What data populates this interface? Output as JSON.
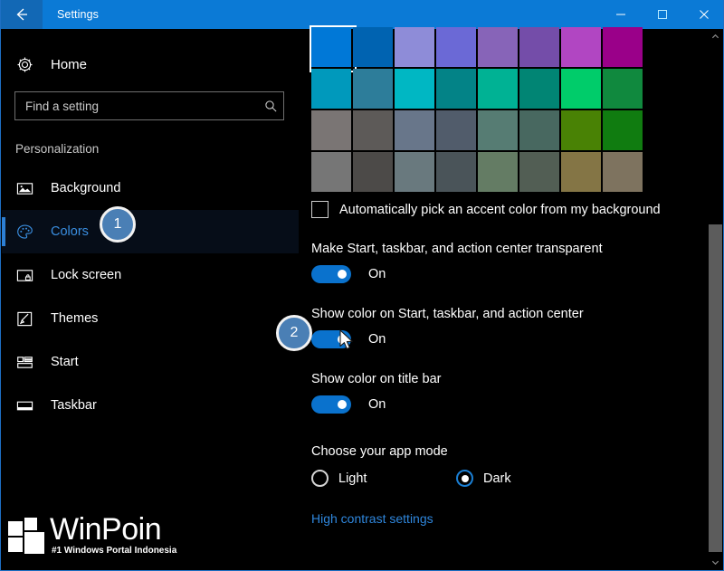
{
  "window": {
    "title": "Settings",
    "back_icon": "back-arrow-icon",
    "minimize_icon": "minimize-icon",
    "maximize_icon": "maximize-icon",
    "close_icon": "close-icon",
    "accent_color": "#0b7ad6",
    "border_color": "#1e6fc4",
    "background_color": "#000000"
  },
  "sidebar": {
    "home": {
      "label": "Home",
      "icon": "gear-icon"
    },
    "search": {
      "placeholder": "Find a setting",
      "value": "",
      "icon": "search-icon"
    },
    "category": "Personalization",
    "items": [
      {
        "label": "Background",
        "icon": "picture-icon",
        "selected": false
      },
      {
        "label": "Colors",
        "icon": "palette-icon",
        "selected": true
      },
      {
        "label": "Lock screen",
        "icon": "lockscreen-icon",
        "selected": false
      },
      {
        "label": "Themes",
        "icon": "brush-icon",
        "selected": false
      },
      {
        "label": "Start",
        "icon": "start-tiles-icon",
        "selected": false
      },
      {
        "label": "Taskbar",
        "icon": "taskbar-icon",
        "selected": false
      }
    ],
    "selected_accent": "#3a8ee0"
  },
  "main": {
    "swatches": {
      "selected_index": 0,
      "rows": [
        [
          "#0078d7",
          "#0063b1",
          "#8e8cd8",
          "#6b69d6",
          "#8764b8",
          "#744da9",
          "#b146c2",
          "#9a0089"
        ],
        [
          "#0099bc",
          "#2d7d9a",
          "#00b7c3",
          "#038387",
          "#00b294",
          "#018574",
          "#00cc6a",
          "#10893e"
        ],
        [
          "#7a7574",
          "#5d5a58",
          "#68768a",
          "#515c6b",
          "#567c73",
          "#486860",
          "#498205",
          "#107c10"
        ],
        [
          "#767676",
          "#4c4a48",
          "#69797e",
          "#4a5459",
          "#647c64",
          "#525e54",
          "#847545",
          "#7e735f"
        ]
      ]
    },
    "auto_accent": {
      "label": "Automatically pick an accent color from my background",
      "checked": false
    },
    "settings": [
      {
        "title": "Make Start, taskbar, and action center transparent",
        "state": "On",
        "on": true
      },
      {
        "title": "Show color on Start, taskbar, and action center",
        "state": "On",
        "on": true
      },
      {
        "title": "Show color on title bar",
        "state": "On",
        "on": true
      }
    ],
    "app_mode": {
      "title": "Choose your app mode",
      "options": [
        {
          "label": "Light",
          "selected": false
        },
        {
          "label": "Dark",
          "selected": true
        }
      ]
    },
    "high_contrast_link": "High contrast settings",
    "link_color": "#2f87dd",
    "toggle_on_color": "#0a72cd"
  },
  "scrollbar": {
    "up_icon": "chevron-up-icon",
    "down_icon": "chevron-down-icon",
    "thumb_color": "#5c5c5c"
  },
  "callouts": [
    {
      "number": "1",
      "color": "#4a7fb5"
    },
    {
      "number": "2",
      "color": "#4a7fb5"
    }
  ],
  "cursor": {
    "icon": "mouse-pointer-icon"
  },
  "watermark": {
    "name": "WinPoin",
    "tagline": "#1 Windows Portal Indonesia"
  }
}
